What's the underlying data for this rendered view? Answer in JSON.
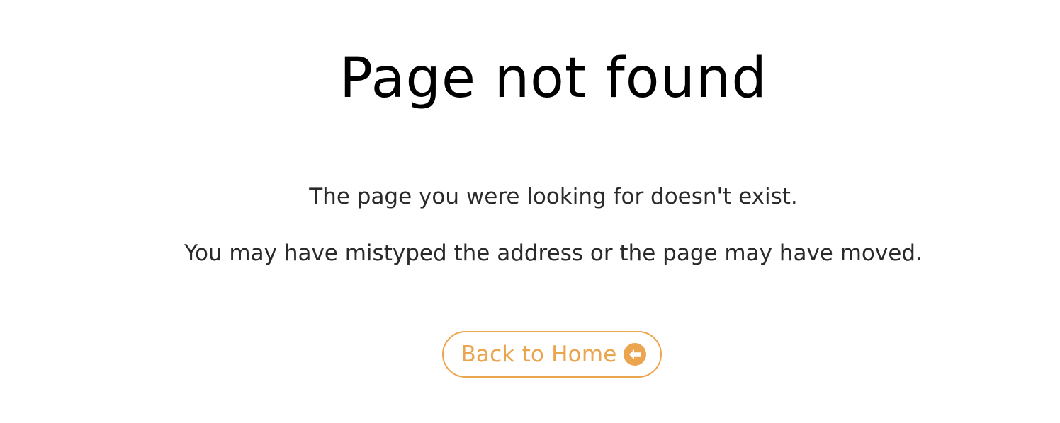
{
  "heading": "Page not found",
  "messages": {
    "line1": "The page you were looking for doesn't exist.",
    "line2": "You may have mistyped the address or the page may have moved."
  },
  "button": {
    "label": "Back to Home",
    "icon": "arrow-circle-left-icon"
  },
  "colors": {
    "accent": "#eba54f",
    "text": "#2a2a2a",
    "heading": "#000000",
    "background": "#ffffff"
  }
}
